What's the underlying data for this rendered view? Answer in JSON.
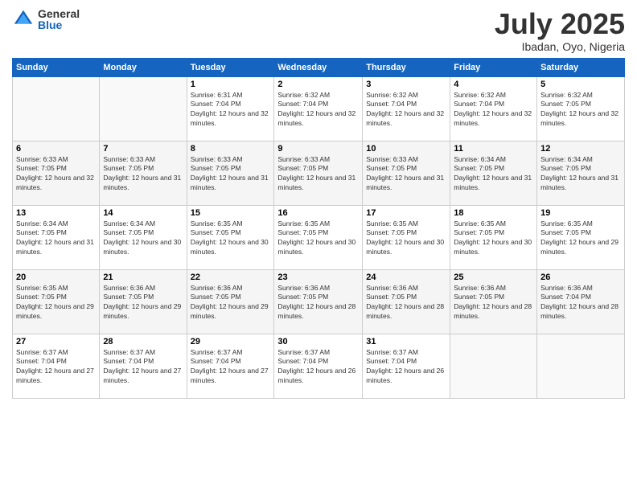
{
  "logo": {
    "general": "General",
    "blue": "Blue"
  },
  "title": {
    "month_year": "July 2025",
    "location": "Ibadan, Oyo, Nigeria"
  },
  "weekdays": [
    "Sunday",
    "Monday",
    "Tuesday",
    "Wednesday",
    "Thursday",
    "Friday",
    "Saturday"
  ],
  "weeks": [
    [
      {
        "day": "",
        "sunrise": "",
        "sunset": "",
        "daylight": ""
      },
      {
        "day": "",
        "sunrise": "",
        "sunset": "",
        "daylight": ""
      },
      {
        "day": "1",
        "sunrise": "Sunrise: 6:31 AM",
        "sunset": "Sunset: 7:04 PM",
        "daylight": "Daylight: 12 hours and 32 minutes."
      },
      {
        "day": "2",
        "sunrise": "Sunrise: 6:32 AM",
        "sunset": "Sunset: 7:04 PM",
        "daylight": "Daylight: 12 hours and 32 minutes."
      },
      {
        "day": "3",
        "sunrise": "Sunrise: 6:32 AM",
        "sunset": "Sunset: 7:04 PM",
        "daylight": "Daylight: 12 hours and 32 minutes."
      },
      {
        "day": "4",
        "sunrise": "Sunrise: 6:32 AM",
        "sunset": "Sunset: 7:04 PM",
        "daylight": "Daylight: 12 hours and 32 minutes."
      },
      {
        "day": "5",
        "sunrise": "Sunrise: 6:32 AM",
        "sunset": "Sunset: 7:05 PM",
        "daylight": "Daylight: 12 hours and 32 minutes."
      }
    ],
    [
      {
        "day": "6",
        "sunrise": "Sunrise: 6:33 AM",
        "sunset": "Sunset: 7:05 PM",
        "daylight": "Daylight: 12 hours and 32 minutes."
      },
      {
        "day": "7",
        "sunrise": "Sunrise: 6:33 AM",
        "sunset": "Sunset: 7:05 PM",
        "daylight": "Daylight: 12 hours and 31 minutes."
      },
      {
        "day": "8",
        "sunrise": "Sunrise: 6:33 AM",
        "sunset": "Sunset: 7:05 PM",
        "daylight": "Daylight: 12 hours and 31 minutes."
      },
      {
        "day": "9",
        "sunrise": "Sunrise: 6:33 AM",
        "sunset": "Sunset: 7:05 PM",
        "daylight": "Daylight: 12 hours and 31 minutes."
      },
      {
        "day": "10",
        "sunrise": "Sunrise: 6:33 AM",
        "sunset": "Sunset: 7:05 PM",
        "daylight": "Daylight: 12 hours and 31 minutes."
      },
      {
        "day": "11",
        "sunrise": "Sunrise: 6:34 AM",
        "sunset": "Sunset: 7:05 PM",
        "daylight": "Daylight: 12 hours and 31 minutes."
      },
      {
        "day": "12",
        "sunrise": "Sunrise: 6:34 AM",
        "sunset": "Sunset: 7:05 PM",
        "daylight": "Daylight: 12 hours and 31 minutes."
      }
    ],
    [
      {
        "day": "13",
        "sunrise": "Sunrise: 6:34 AM",
        "sunset": "Sunset: 7:05 PM",
        "daylight": "Daylight: 12 hours and 31 minutes."
      },
      {
        "day": "14",
        "sunrise": "Sunrise: 6:34 AM",
        "sunset": "Sunset: 7:05 PM",
        "daylight": "Daylight: 12 hours and 30 minutes."
      },
      {
        "day": "15",
        "sunrise": "Sunrise: 6:35 AM",
        "sunset": "Sunset: 7:05 PM",
        "daylight": "Daylight: 12 hours and 30 minutes."
      },
      {
        "day": "16",
        "sunrise": "Sunrise: 6:35 AM",
        "sunset": "Sunset: 7:05 PM",
        "daylight": "Daylight: 12 hours and 30 minutes."
      },
      {
        "day": "17",
        "sunrise": "Sunrise: 6:35 AM",
        "sunset": "Sunset: 7:05 PM",
        "daylight": "Daylight: 12 hours and 30 minutes."
      },
      {
        "day": "18",
        "sunrise": "Sunrise: 6:35 AM",
        "sunset": "Sunset: 7:05 PM",
        "daylight": "Daylight: 12 hours and 30 minutes."
      },
      {
        "day": "19",
        "sunrise": "Sunrise: 6:35 AM",
        "sunset": "Sunset: 7:05 PM",
        "daylight": "Daylight: 12 hours and 29 minutes."
      }
    ],
    [
      {
        "day": "20",
        "sunrise": "Sunrise: 6:35 AM",
        "sunset": "Sunset: 7:05 PM",
        "daylight": "Daylight: 12 hours and 29 minutes."
      },
      {
        "day": "21",
        "sunrise": "Sunrise: 6:36 AM",
        "sunset": "Sunset: 7:05 PM",
        "daylight": "Daylight: 12 hours and 29 minutes."
      },
      {
        "day": "22",
        "sunrise": "Sunrise: 6:36 AM",
        "sunset": "Sunset: 7:05 PM",
        "daylight": "Daylight: 12 hours and 29 minutes."
      },
      {
        "day": "23",
        "sunrise": "Sunrise: 6:36 AM",
        "sunset": "Sunset: 7:05 PM",
        "daylight": "Daylight: 12 hours and 28 minutes."
      },
      {
        "day": "24",
        "sunrise": "Sunrise: 6:36 AM",
        "sunset": "Sunset: 7:05 PM",
        "daylight": "Daylight: 12 hours and 28 minutes."
      },
      {
        "day": "25",
        "sunrise": "Sunrise: 6:36 AM",
        "sunset": "Sunset: 7:05 PM",
        "daylight": "Daylight: 12 hours and 28 minutes."
      },
      {
        "day": "26",
        "sunrise": "Sunrise: 6:36 AM",
        "sunset": "Sunset: 7:04 PM",
        "daylight": "Daylight: 12 hours and 28 minutes."
      }
    ],
    [
      {
        "day": "27",
        "sunrise": "Sunrise: 6:37 AM",
        "sunset": "Sunset: 7:04 PM",
        "daylight": "Daylight: 12 hours and 27 minutes."
      },
      {
        "day": "28",
        "sunrise": "Sunrise: 6:37 AM",
        "sunset": "Sunset: 7:04 PM",
        "daylight": "Daylight: 12 hours and 27 minutes."
      },
      {
        "day": "29",
        "sunrise": "Sunrise: 6:37 AM",
        "sunset": "Sunset: 7:04 PM",
        "daylight": "Daylight: 12 hours and 27 minutes."
      },
      {
        "day": "30",
        "sunrise": "Sunrise: 6:37 AM",
        "sunset": "Sunset: 7:04 PM",
        "daylight": "Daylight: 12 hours and 26 minutes."
      },
      {
        "day": "31",
        "sunrise": "Sunrise: 6:37 AM",
        "sunset": "Sunset: 7:04 PM",
        "daylight": "Daylight: 12 hours and 26 minutes."
      },
      {
        "day": "",
        "sunrise": "",
        "sunset": "",
        "daylight": ""
      },
      {
        "day": "",
        "sunrise": "",
        "sunset": "",
        "daylight": ""
      }
    ]
  ]
}
